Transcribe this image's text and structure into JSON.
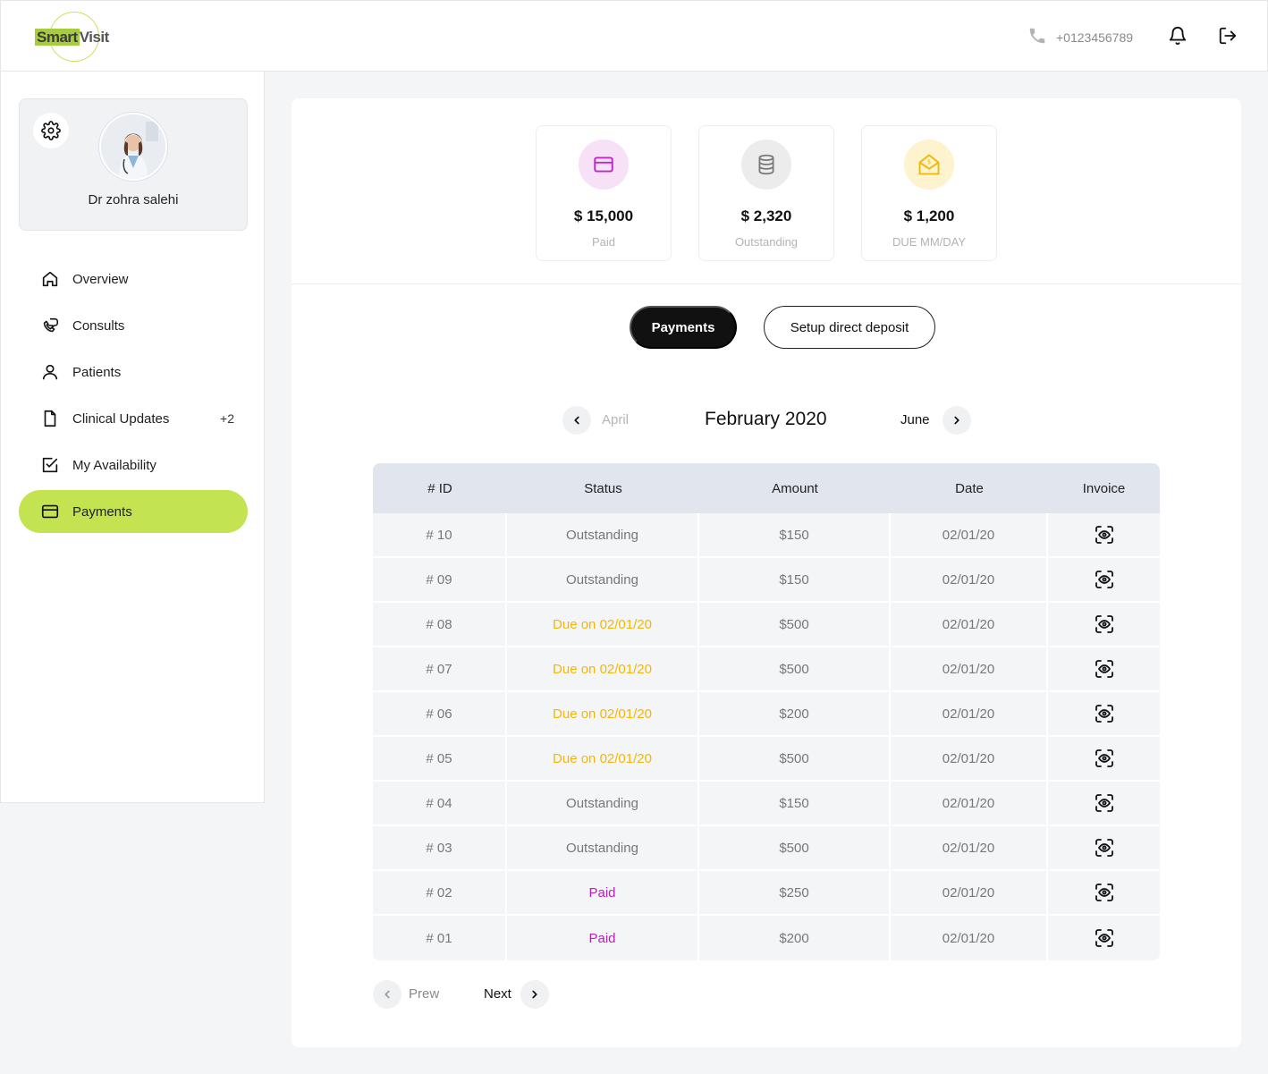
{
  "header": {
    "logo_smart": "Smart",
    "logo_visit": "Visit",
    "phone": "+0123456789"
  },
  "profile": {
    "name": "Dr zohra salehi"
  },
  "sidebar": {
    "items": [
      {
        "label": "Overview",
        "icon": "home-icon"
      },
      {
        "label": "Consults",
        "icon": "phone-chat-icon"
      },
      {
        "label": "Patients",
        "icon": "user-icon"
      },
      {
        "label": "Clinical Updates",
        "icon": "document-icon",
        "badge": "+2"
      },
      {
        "label": "My Availability",
        "icon": "checkbox-icon"
      },
      {
        "label": "Payments",
        "icon": "card-icon",
        "active": true
      }
    ]
  },
  "summary": [
    {
      "amount": "$ 15,000",
      "label": "Paid",
      "icon": "credit-card-icon",
      "color": "#c227c9",
      "bg": "#f7e1f7"
    },
    {
      "amount": "$ 2,320",
      "label": "Outstanding",
      "icon": "coins-stack-icon",
      "color": "#8a8a8a",
      "bg": "#ececec"
    },
    {
      "amount": "$ 1,200",
      "label": "DUE MM/DAY",
      "icon": "money-envelope-icon",
      "color": "#f2b705",
      "bg": "#fdf3cf"
    }
  ],
  "tabs": {
    "payments": "Payments",
    "setup": "Setup direct deposit"
  },
  "month_nav": {
    "prev": "April",
    "current": "February 2020",
    "next": "June"
  },
  "table": {
    "headers": [
      "# ID",
      "Status",
      "Amount",
      "Date",
      "Invoice"
    ],
    "rows": [
      {
        "id": "# 10",
        "status": "Outstanding",
        "amount": "$150",
        "date": "02/01/20"
      },
      {
        "id": "# 09",
        "status": "Outstanding",
        "amount": "$150",
        "date": "02/01/20"
      },
      {
        "id": "# 08",
        "status": "Due on 02/01/20",
        "amount": "$500",
        "date": "02/01/20"
      },
      {
        "id": "# 07",
        "status": "Due on 02/01/20",
        "amount": "$500",
        "date": "02/01/20"
      },
      {
        "id": "# 06",
        "status": "Due on 02/01/20",
        "amount": "$200",
        "date": "02/01/20"
      },
      {
        "id": "# 05",
        "status": "Due on 02/01/20",
        "amount": "$500",
        "date": "02/01/20"
      },
      {
        "id": "# 04",
        "status": "Outstanding",
        "amount": "$150",
        "date": "02/01/20"
      },
      {
        "id": "# 03",
        "status": "Outstanding",
        "amount": "$500",
        "date": "02/01/20"
      },
      {
        "id": "# 02",
        "status": "Paid",
        "amount": "$250",
        "date": "02/01/20"
      },
      {
        "id": "# 01",
        "status": "Paid",
        "amount": "$200",
        "date": "02/01/20"
      }
    ]
  },
  "status_colors": {
    "Outstanding": "#777777",
    "Due on 02/01/20": "#f2b705",
    "Paid": "#b620b8"
  },
  "pagination": {
    "prev": "Prew",
    "next": "Next"
  }
}
